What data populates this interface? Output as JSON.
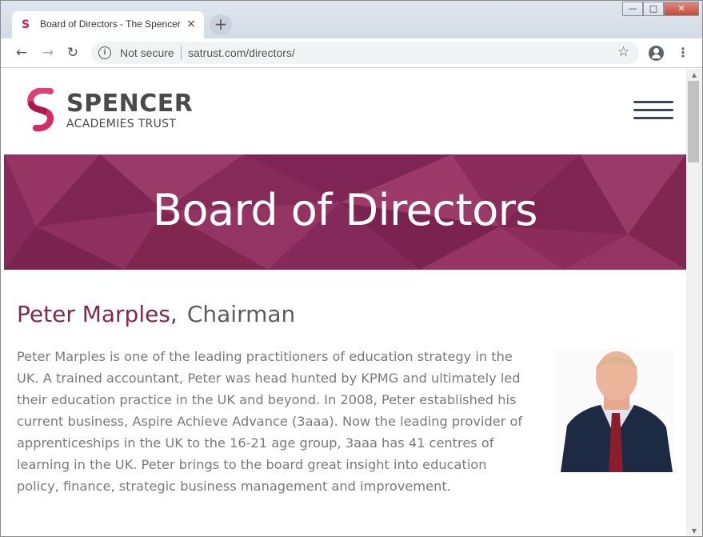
{
  "browser": {
    "tab_title": "Board of Directors - The Spencer",
    "tab_favicon": "S",
    "tab_close": "×",
    "new_tab": "+",
    "window_buttons": {
      "minimize": "—",
      "maximize": "□",
      "close": "✕"
    },
    "nav": {
      "back": "←",
      "forward": "→",
      "reload": "↻"
    },
    "security_label": "Not secure",
    "url": "satrust.com/directors/",
    "bookmark_icon": "☆",
    "menu_icon": "⋮"
  },
  "site": {
    "logo_word": "SPENCER",
    "logo_sub": "ACADEMIES TRUST",
    "brand_colors": {
      "pink": "#e0407a",
      "magenta": "#c51f5d",
      "plum": "#8b2c5a"
    }
  },
  "hero": {
    "title": "Board of Directors"
  },
  "director": {
    "name": "Peter Marples,",
    "role": "Chairman",
    "bio": "Peter Marples is one of the leading practitioners of education strategy in the UK. A trained accountant, Peter was head hunted by KPMG and ultimately led their education practice in the UK and beyond. In 2008, Peter established his current business, Aspire Achieve Advance (3aaa). Now the leading provider of apprenticeships in the UK to the 16-21 age group, 3aaa has 41 centres of learning in the UK. Peter brings to the board great insight into education policy, finance, strategic business management and improvement."
  },
  "scrollbar": {
    "up": "▲",
    "down": "▼"
  }
}
